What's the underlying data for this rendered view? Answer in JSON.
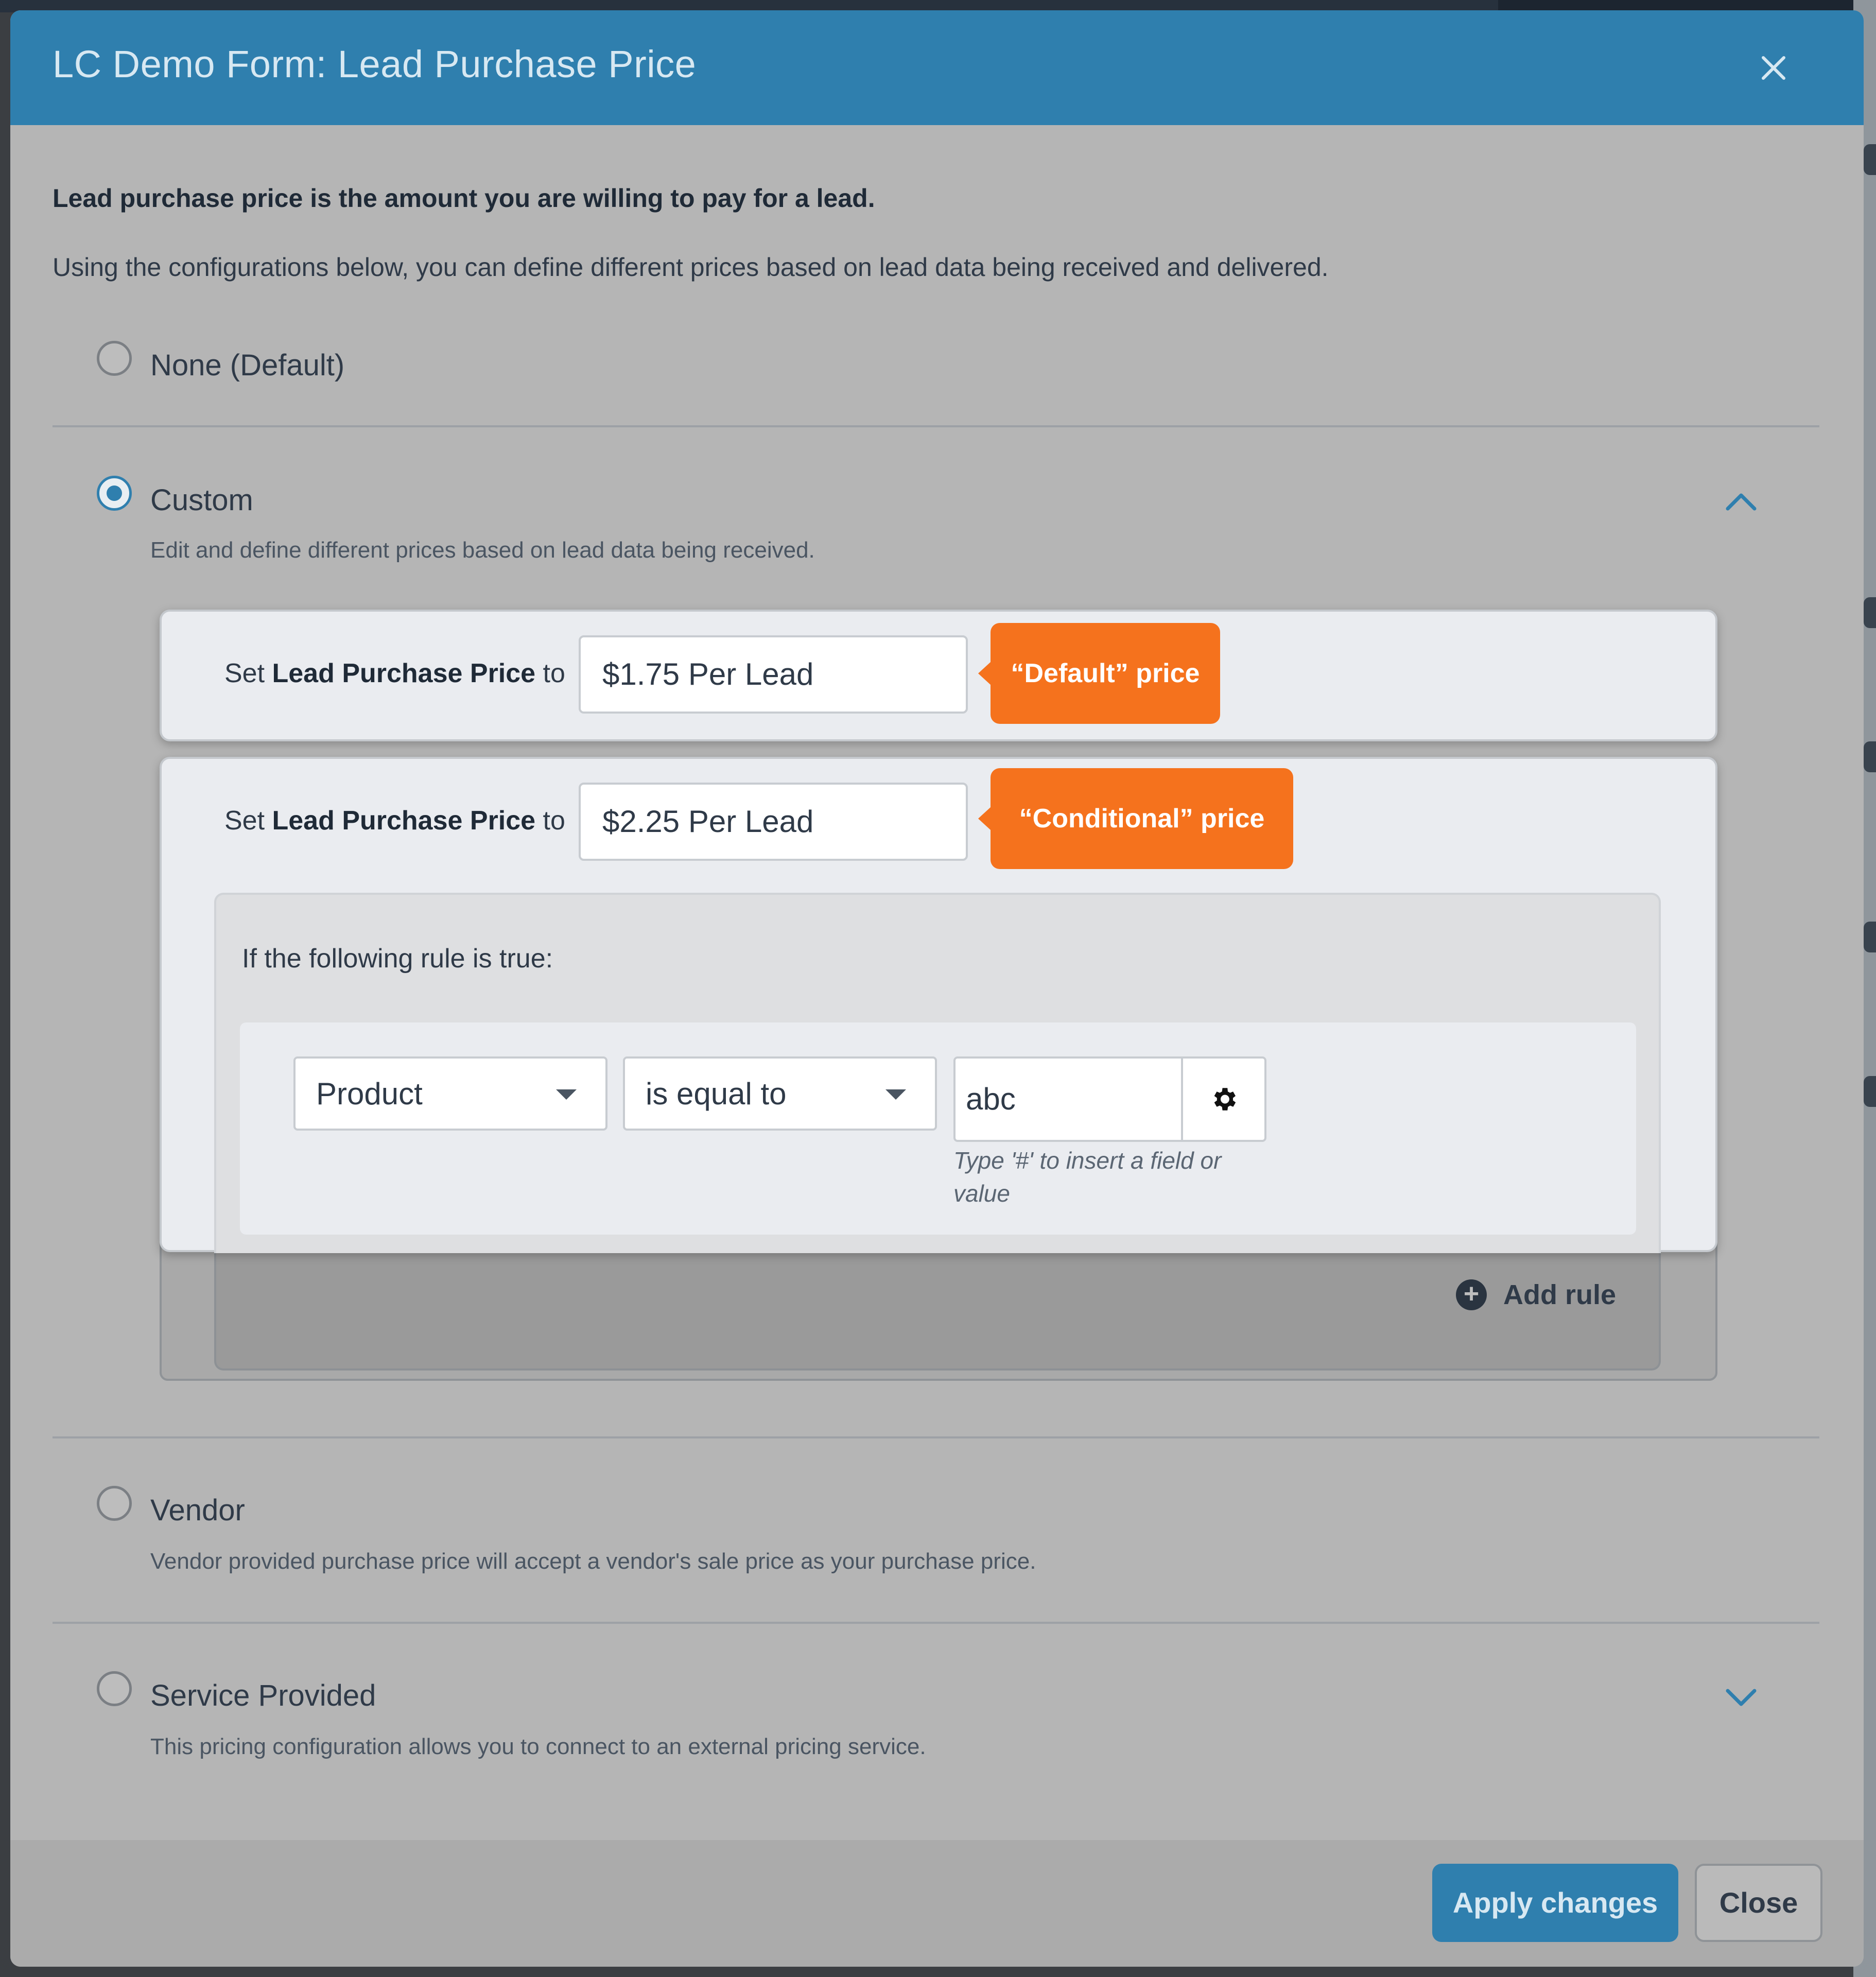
{
  "modal": {
    "title": "LC Demo Form: Lead Purchase Price",
    "close_icon": "close-icon"
  },
  "intro": {
    "bold_line": "Lead purchase price is the amount you are willing to pay for a lead.",
    "description": "Using the configurations below, you can define different prices based on lead data being received and delivered."
  },
  "options": {
    "none": {
      "label": "None (Default)",
      "selected": false
    },
    "custom": {
      "label": "Custom",
      "selected": true,
      "description": "Edit and define different prices based on lead data being received.",
      "expanded": true
    },
    "vendor": {
      "label": "Vendor",
      "selected": false,
      "description": "Vendor provided purchase price will accept a vendor's sale price as your purchase price."
    },
    "service": {
      "label": "Service Provided",
      "selected": false,
      "description": "This pricing configuration allows you to connect to an external pricing service.",
      "expanded": false
    }
  },
  "default_price": {
    "prefix": "Set ",
    "field": "Lead Purchase Price",
    "suffix": " to",
    "value": "$1.75 Per Lead",
    "callout": "“Default” price"
  },
  "conditional_price": {
    "prefix": "Set ",
    "field": "Lead Purchase Price",
    "suffix": " to",
    "value": "$2.25 Per Lead",
    "callout": "“Conditional” price",
    "rule_heading": "If the following rule is true:",
    "rule": {
      "field": "Product",
      "operator": "is equal to",
      "value": "abc",
      "hint": "Type '#' to insert a field or value"
    },
    "add_rule_label": "Add rule"
  },
  "footer": {
    "apply_label": "Apply changes",
    "close_label": "Close"
  },
  "colors": {
    "header": "#2f7fae",
    "accent": "#2f7fae",
    "callout": "#f5721d"
  }
}
